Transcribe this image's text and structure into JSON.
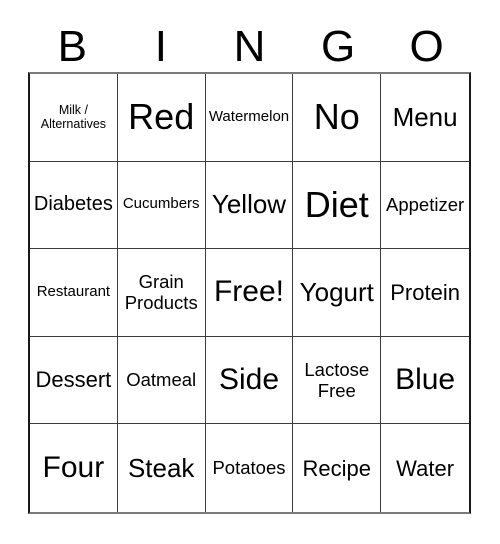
{
  "card": {
    "header_letters": [
      "B",
      "I",
      "N",
      "G",
      "O"
    ],
    "grid_size": 5,
    "background_color": "#ffffff",
    "text_color": "#000000",
    "border_color": "#3c3c3c",
    "outer_border_color": "#1a1a1a",
    "rows": [
      [
        {
          "text": "Milk /\nAlternatives",
          "size": "xs",
          "lines": 2
        },
        {
          "text": "Red",
          "size": "3x",
          "lines": 1
        },
        {
          "text": "Watermelon",
          "size": "s",
          "lines": 1
        },
        {
          "text": "No",
          "size": "3x",
          "lines": 1
        },
        {
          "text": "Menu",
          "size": "xl",
          "lines": 1
        }
      ],
      [
        {
          "text": "Diabetes",
          "size": "l",
          "lines": 1
        },
        {
          "text": "Cucumbers",
          "size": "s",
          "lines": 1
        },
        {
          "text": "Yellow",
          "size": "xl",
          "lines": 1
        },
        {
          "text": "Diet",
          "size": "3x",
          "lines": 1
        },
        {
          "text": "Appetizer",
          "size": "m",
          "lines": 1
        }
      ],
      [
        {
          "text": "Restaurant",
          "size": "s",
          "lines": 1
        },
        {
          "text": "Grain\nProducts",
          "size": "m",
          "lines": 2
        },
        {
          "text": "Free!",
          "size": "2x",
          "lines": 1
        },
        {
          "text": "Yogurt",
          "size": "xl",
          "lines": 1
        },
        {
          "text": "Protein",
          "size": "l",
          "lines": 1
        }
      ],
      [
        {
          "text": "Dessert",
          "size": "l",
          "lines": 1
        },
        {
          "text": "Oatmeal",
          "size": "m",
          "lines": 1
        },
        {
          "text": "Side",
          "size": "2x",
          "lines": 1
        },
        {
          "text": "Lactose\nFree",
          "size": "m",
          "lines": 2
        },
        {
          "text": "Blue",
          "size": "2x",
          "lines": 1
        }
      ],
      [
        {
          "text": "Four",
          "size": "2x",
          "lines": 1
        },
        {
          "text": "Steak",
          "size": "xl",
          "lines": 1
        },
        {
          "text": "Potatoes",
          "size": "m",
          "lines": 1
        },
        {
          "text": "Recipe",
          "size": "l",
          "lines": 1
        },
        {
          "text": "Water",
          "size": "l",
          "lines": 1
        }
      ]
    ]
  }
}
